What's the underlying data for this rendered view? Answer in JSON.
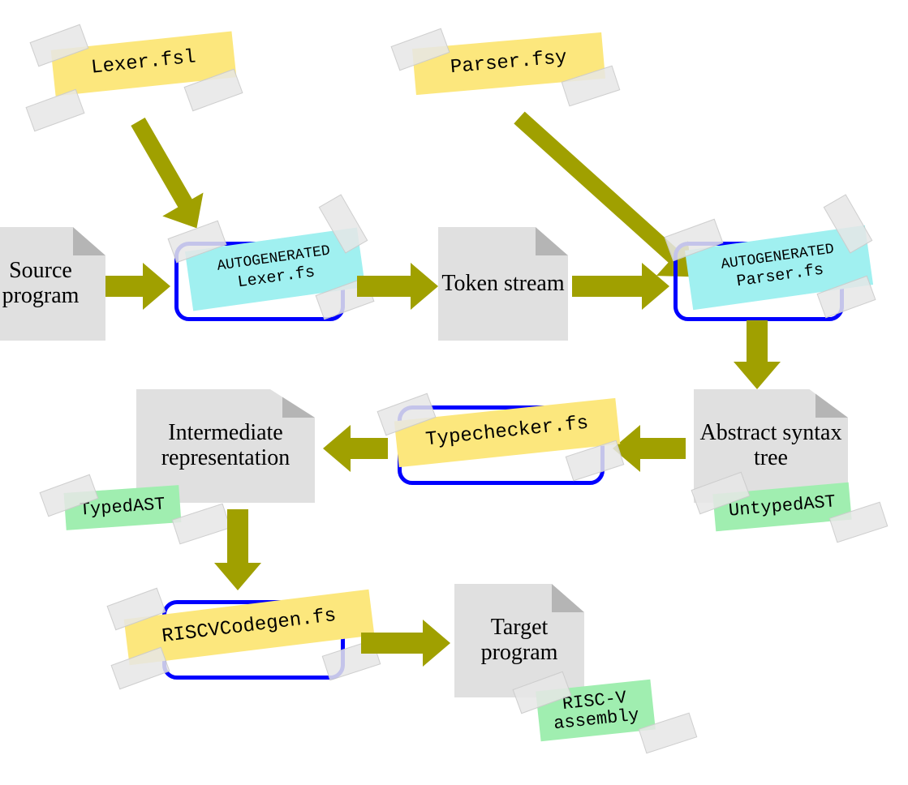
{
  "top_notes": {
    "lexer_src": "Lexer.fsl",
    "parser_src": "Parser.fsy"
  },
  "docs": {
    "source": "Source program",
    "tokens": "Token stream",
    "ast": "Abstract syntax tree",
    "ir": "Intermediate representation",
    "target": "Target program"
  },
  "proc_notes": {
    "lexer_auto_line1": "AUTOGENERATED",
    "lexer_auto_line2": "Lexer.fs",
    "parser_auto_line1": "AUTOGENERATED",
    "parser_auto_line2": "Parser.fs",
    "typechecker": "Typechecker.fs",
    "codegen": "RISCVCodegen.fs"
  },
  "green_notes": {
    "untyped": "UntypedAST",
    "typed": "TypedAST",
    "riscv_l1": "RISC-V",
    "riscv_l2": "assembly"
  }
}
